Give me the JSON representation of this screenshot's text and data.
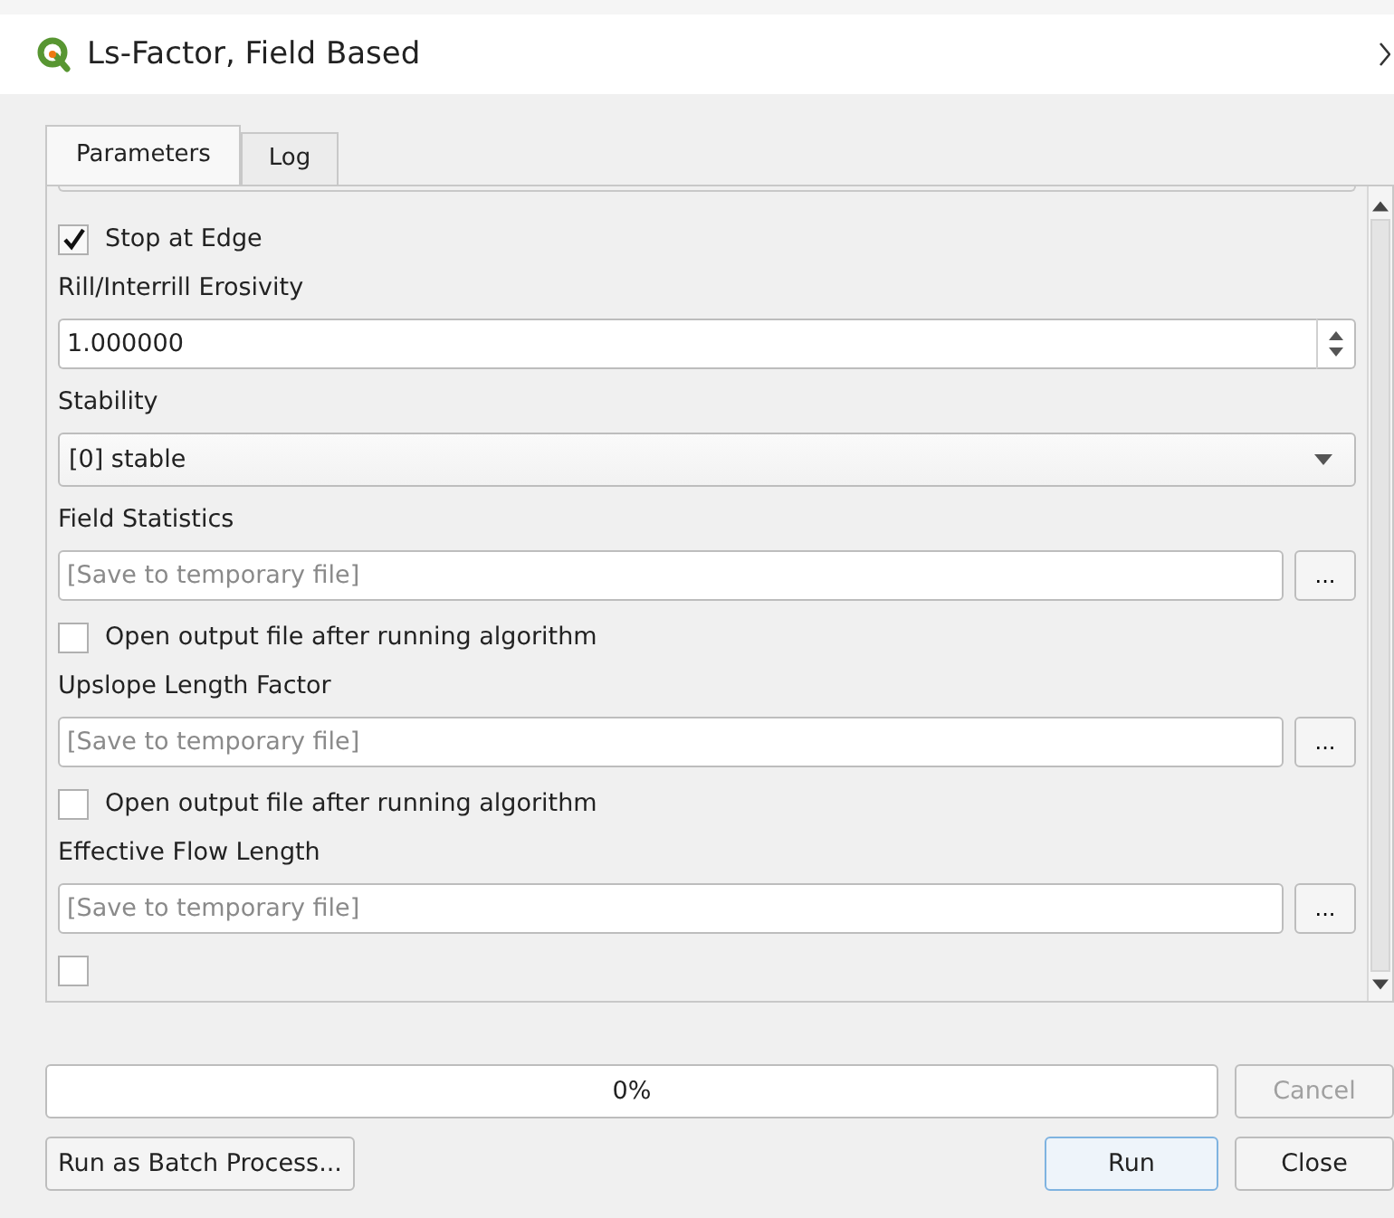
{
  "window": {
    "title": "Ls-Factor, Field Based"
  },
  "tabs": [
    {
      "label": "Parameters",
      "selected": true
    },
    {
      "label": "Log",
      "selected": false
    }
  ],
  "parameters": [
    {
      "kind": "checkbox",
      "label": "Stop at Edge",
      "checked": true
    },
    {
      "kind": "label",
      "label": "Rill/Interrill Erosivity"
    },
    {
      "kind": "spinbox",
      "value": "1.000000"
    },
    {
      "kind": "label",
      "label": "Stability"
    },
    {
      "kind": "combo",
      "value": "[0] stable"
    },
    {
      "kind": "label",
      "label": "Field Statistics"
    },
    {
      "kind": "file",
      "placeholder": "[Save to temporary file]",
      "button": "..."
    },
    {
      "kind": "checkbox",
      "label": "Open output file after running algorithm",
      "checked": false
    },
    {
      "kind": "label",
      "label": "Upslope Length Factor"
    },
    {
      "kind": "file",
      "placeholder": "[Save to temporary file]",
      "button": "..."
    },
    {
      "kind": "checkbox",
      "label": "Open output file after running algorithm",
      "checked": false
    },
    {
      "kind": "label",
      "label": "Effective Flow Length"
    },
    {
      "kind": "file",
      "placeholder": "[Save to temporary file]",
      "button": "..."
    },
    {
      "kind": "checkbox",
      "checked": false
    }
  ],
  "progress": {
    "level": 0,
    "text": "0%"
  },
  "cancel_button": {
    "label": "Cancel",
    "disabled": true
  },
  "batch_button": {
    "label": "Run as Batch Process..."
  },
  "action_buttons": [
    {
      "label": "Run",
      "default": true
    },
    {
      "label": "Close",
      "default": false
    }
  ]
}
